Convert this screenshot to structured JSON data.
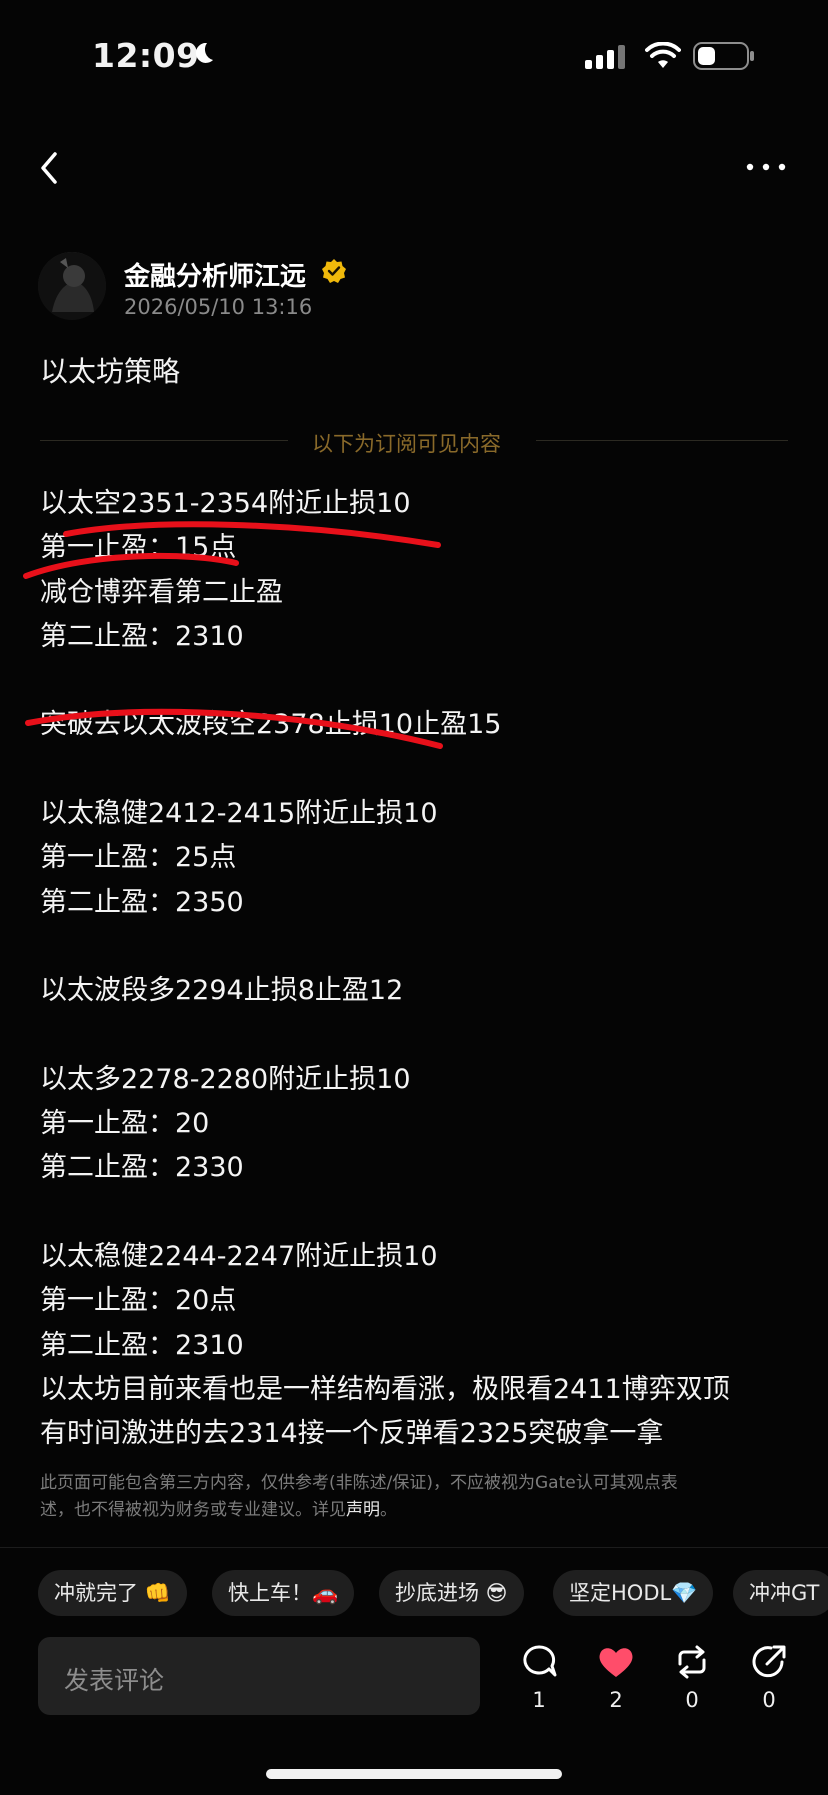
{
  "status_bar": {
    "time": "12:09"
  },
  "author": {
    "name": "金融分析师江远",
    "date": "2026/05/10 13:16"
  },
  "post": {
    "title": "以太坊策略",
    "subscription_hint": "以下为订阅可见内容",
    "lines": [
      "以太空2351-2354附近止损10",
      "第一止盈：15点",
      "减仓博弈看第二止盈",
      "第二止盈：2310",
      "",
      "突破去以太波段空2378止损10止盈15",
      "",
      "以太稳健2412-2415附近止损10",
      "第一止盈：25点",
      "第二止盈：2350",
      "",
      "以太波段多2294止损8止盈12",
      "",
      "以太多2278-2280附近止损10",
      "第一止盈：20",
      "第二止盈：2330",
      "",
      "以太稳健2244-2247附近止损10",
      "第一止盈：20点",
      "第二止盈：2310",
      "以太坊目前来看也是一样结构看涨，极限看2411博弈双顶",
      "有时间激进的去2314接一个反弹看2325突破拿一拿"
    ],
    "disclaimer_line1": "此页面可能包含第三方内容，仅供参考(非陈述/保证)，不应被视为Gate认可其观点表",
    "disclaimer_line2": "述，也不得被视为财务或专业建议。详见",
    "disclaimer_link": "声明",
    "disclaimer_end": "。"
  },
  "quick_replies": [
    "冲就完了 👊",
    "快上车！🚗",
    "抄底进场 😎",
    "坚定HODL💎",
    "冲冲GT"
  ],
  "comment": {
    "placeholder": "发表评论"
  },
  "actions": {
    "comments": "1",
    "likes": "2",
    "reposts": "0",
    "shares": "0"
  },
  "colors": {
    "background": "#050505",
    "verified_badge": "#f0b90b",
    "like_heart": "#ff4d6a",
    "annotation_stroke": "#e8101a",
    "subscription_hint": "#8a6a2a"
  },
  "icons": [
    "back-icon",
    "more-icon",
    "verified-icon",
    "comment-icon",
    "heart-icon",
    "repost-icon",
    "share-icon"
  ]
}
